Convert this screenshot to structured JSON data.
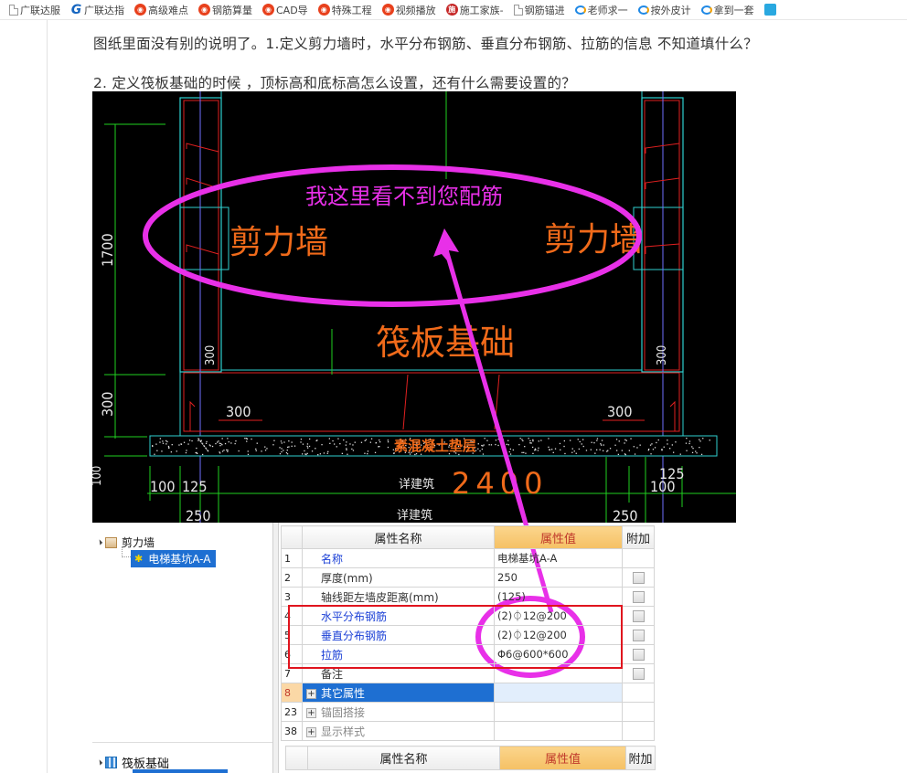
{
  "bookmarks": [
    {
      "label": "广联达服",
      "icon": "page-icon"
    },
    {
      "label": "广联达指",
      "icon": "g-logo-icon"
    },
    {
      "label": "高级难点",
      "icon": "weibo-icon"
    },
    {
      "label": "钢筋算量",
      "icon": "weibo-icon"
    },
    {
      "label": "CAD导",
      "icon": "weibo-icon"
    },
    {
      "label": "特殊工程",
      "icon": "weibo-icon"
    },
    {
      "label": "视频播放",
      "icon": "weibo-icon"
    },
    {
      "label": "施工家族-",
      "icon": "shi-icon"
    },
    {
      "label": "钢筋锚进",
      "icon": "page-icon"
    },
    {
      "label": "老师求一",
      "icon": "ie-icon"
    },
    {
      "label": "按外皮计",
      "icon": "ie-icon"
    },
    {
      "label": "拿到一套",
      "icon": "ie-icon"
    }
  ],
  "post": {
    "question1": "图纸里面没有别的说明了。1.定义剪力墙时，水平分布钢筋、垂直分布钢筋、拉筋的信息 不知道填什么？",
    "question2": "2. 定义筏板基础的时候 ，顶标高和底标高怎么设置，还有什么需要设置的？"
  },
  "cad": {
    "annotation": "我这里看不到您配筋",
    "left_wall_label": "剪力墙",
    "right_wall_label": "剪力墙",
    "raft_label": "筏板基础",
    "cushion_label": "素混凝土垫层",
    "dim_height_1700": "1700",
    "dim_height_300": "300",
    "dim_height_100": "100",
    "dim_inner_left_300_v": "300",
    "dim_inner_right_300_v": "300",
    "dim_inner_left_300_h": "300",
    "dim_inner_right_300_h": "300",
    "dim_left_100": "100",
    "dim_left_125": "125",
    "dim_left_250": "250",
    "dim_right_100": "100",
    "dim_right_125": "125",
    "dim_right_250": "250",
    "dim_width_2400": "2400",
    "see_arch_1": "详建筑",
    "see_arch_2": "详建筑",
    "colors": {
      "annotation": "#e830e8",
      "label": "#f06a1a",
      "rebar": "#e02020",
      "outline": "#30d0d0",
      "dimension": "#20d020",
      "axis": "#7070ff"
    }
  },
  "tree1": {
    "parent": "剪力墙",
    "child": "电梯基坑A-A"
  },
  "tree2": {
    "parent": "筏板基础"
  },
  "props": {
    "headers": {
      "name": "属性名称",
      "value": "属性值",
      "extra": "附加"
    },
    "rows": [
      {
        "num": "1",
        "name": "名称",
        "value": "电梯基坑A-A",
        "checkbox": false,
        "style": "blue"
      },
      {
        "num": "2",
        "name": "厚度(mm)",
        "value": "250",
        "checkbox": true,
        "style": "normal"
      },
      {
        "num": "3",
        "name": "轴线距左墙皮距离(mm)",
        "value": "(125)",
        "checkbox": true,
        "style": "normal"
      },
      {
        "num": "4",
        "name": "水平分布钢筋",
        "value": "(2)⏀12@200",
        "checkbox": true,
        "style": "blue"
      },
      {
        "num": "5",
        "name": "垂直分布钢筋",
        "value": "(2)⏀12@200",
        "checkbox": true,
        "style": "blue"
      },
      {
        "num": "6",
        "name": "拉筋",
        "value": "Φ6@600*600",
        "checkbox": true,
        "style": "blue"
      },
      {
        "num": "7",
        "name": "备注",
        "value": "",
        "checkbox": true,
        "style": "normal"
      },
      {
        "num": "8",
        "name": "其它属性",
        "value": "",
        "checkbox": false,
        "style": "selected-group"
      },
      {
        "num": "23",
        "name": "锚固搭接",
        "value": "",
        "checkbox": false,
        "style": "group"
      },
      {
        "num": "38",
        "name": "显示样式",
        "value": "",
        "checkbox": false,
        "style": "group"
      }
    ],
    "expand_symbol": "+"
  },
  "props2": {
    "headers": {
      "name": "属性名称",
      "value": "属性值",
      "extra": "附加"
    }
  },
  "overlay": {
    "highlight_color": "#e830e8",
    "box_color": "#e0141e"
  }
}
